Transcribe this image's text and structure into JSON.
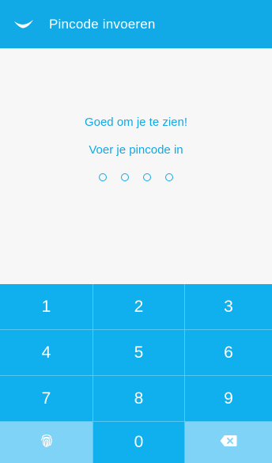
{
  "header": {
    "title": "Pincode invoeren",
    "logo_icon": "wing-logo-icon"
  },
  "main": {
    "greeting": "Goed om je te zien!",
    "prompt": "Voer je pincode in",
    "pin_length": 4,
    "pin_filled": 0
  },
  "keypad": {
    "k1": "1",
    "k2": "2",
    "k3": "3",
    "k4": "4",
    "k5": "5",
    "k6": "6",
    "k7": "7",
    "k8": "8",
    "k9": "9",
    "k0": "0",
    "fingerprint_icon": "fingerprint-icon",
    "backspace_icon": "backspace-icon"
  },
  "colors": {
    "primary": "#11a9e6",
    "key": "#10b0ee",
    "key_light": "#7ed3f6",
    "background": "#f7f7f7"
  }
}
